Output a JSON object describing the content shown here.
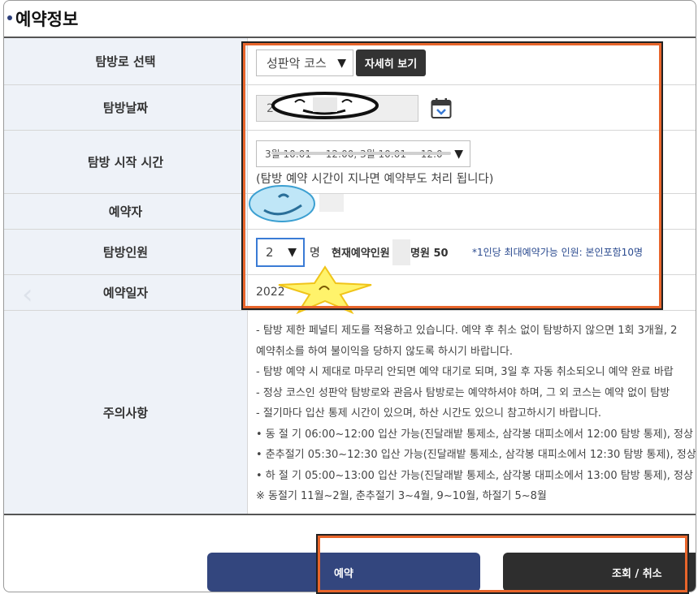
{
  "page": {
    "title": "예약정보"
  },
  "form": {
    "route": {
      "label": "탐방로 선택",
      "selected": "성판악 코스",
      "detail_button": "자세히 보기"
    },
    "date": {
      "label": "탐방날짜",
      "value": "2"
    },
    "start_time": {
      "label": "탐방 시작 시간",
      "selected": "3월 10:01 ~ 12:00, 3월 10:01 ~ 12:0",
      "note": "(탐방 예약 시간이 지나면 예약부도 처리 됩니다)"
    },
    "reserver": {
      "label": "예약자"
    },
    "people": {
      "label": "탐방인원",
      "selected": "2",
      "unit": "명",
      "current_label": "현재예약인원",
      "current_suffix": "명원 50",
      "limit_note": "*1인당 최대예약가능 인원: 본인포함10명"
    },
    "reservation_date": {
      "label": "예약일자",
      "value": "2022"
    },
    "notice": {
      "label": "주의사항",
      "lines": [
        "-  탐방 제한 페널티 제도를 적용하고 있습니다. 예약 후 취소 없이 탐방하지 않으면 1회 3개월, 2",
        "    예약취소를 하여 불이익을 당하지 않도록 하시기 바랍니다.",
        "-  탐방 예약 시 제대로 마무리 안되면 예약 대기로 되며, 3일 후 자동 취소되오니 예약 완료 바랍",
        "-  정상 코스인 성판악 탐방로와 관음사 탐방로는 예약하셔야 하며, 그 외 코스는 예약 없이 탐방",
        "-  절기마다 입산 통제 시간이 있으며, 하산 시간도 있으니 참고하시기 바랍니다.",
        "   • 동 절 기 06:00~12:00 입산 가능(진달래밭 통제소, 삼각봉 대피소에서 12:00 탐방 통제), 정상",
        "   • 춘추절기 05:30~12:30 입산 가능(진달래밭 통제소, 삼각봉 대피소에서 12:30 탐방 통제), 정상",
        "   • 하 절 기 05:00~13:00 입산 가능(진달래밭 통제소, 삼각봉 대피소에서 13:00 탐방 통제), 정상",
        "   ※ 동절기 11월~2월, 춘추절기 3~4월, 9~10월, 하절기 5~8월"
      ]
    }
  },
  "buttons": {
    "reserve": "예약",
    "lookup_cancel": "조회 / 취소"
  },
  "icons": {
    "calendar": "calendar-icon",
    "dropdown": "caret-down-icon",
    "prev": "chevron-left-icon"
  },
  "colors": {
    "label_bg": "#eef2f8",
    "reserve_button": "#33467e",
    "lookup_button": "#2e2e2e",
    "highlight": "#e8652b"
  }
}
